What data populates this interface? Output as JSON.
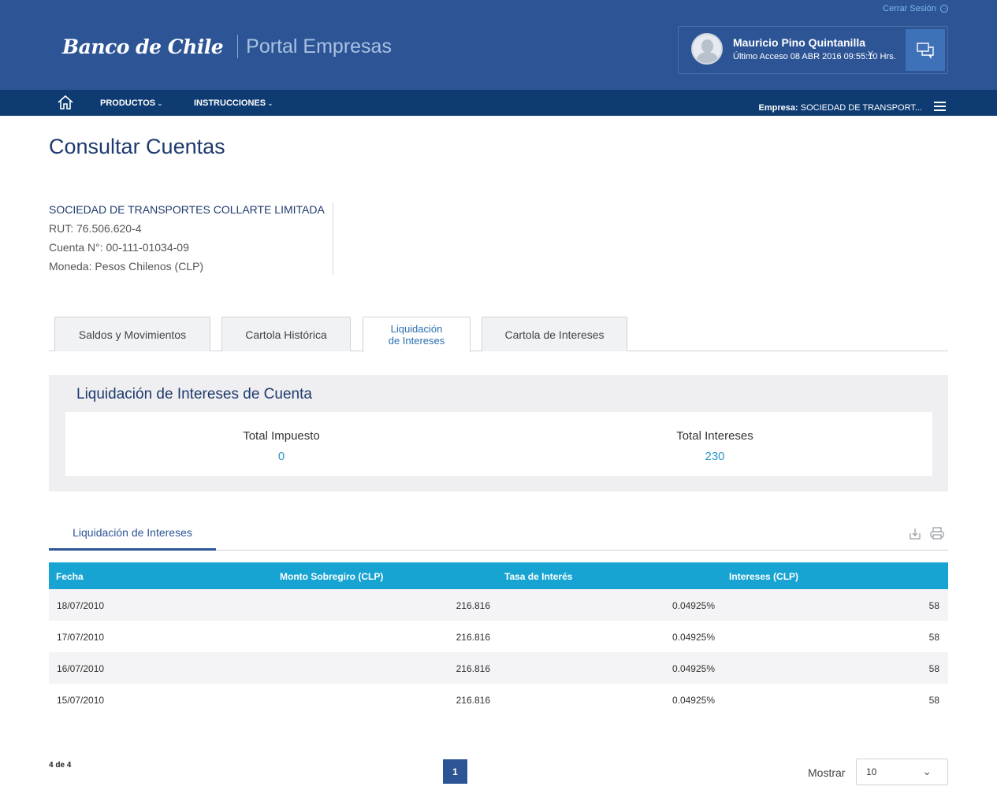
{
  "header": {
    "logout_label": "Cerrar Sesión",
    "brand_logo": "Banco de Chile",
    "brand_portal": "Portal Empresas",
    "user_name": "Mauricio Pino Quintanilla",
    "user_last_access": "Último Acceso 08 ABR 2016 09:55:10 Hrs.",
    "close_glyph": "✕"
  },
  "nav": {
    "products_label": "PRODUCTOS",
    "instructions_label": "INSTRUCCIONES",
    "company_prefix": "Empresa:",
    "company_value": "SOCIEDAD DE TRANSPORT..."
  },
  "page": {
    "title": "Consultar Cuentas"
  },
  "account": {
    "name": "SOCIEDAD DE TRANSPORTES COLLARTE LIMITADA",
    "rut": "RUT: 76.506.620-4",
    "number": "Cuenta N°: 00-111-01034-09",
    "currency": "Moneda: Pesos Chilenos (CLP)"
  },
  "tabs": {
    "t1": "Saldos y Movimientos",
    "t2": "Cartola Histórica",
    "t3_line1": "Liquidación",
    "t3_line2": "de Intereses",
    "t4": "Cartola de Intereses"
  },
  "summary": {
    "title": "Liquidación de Intereses de Cuenta",
    "tax_label": "Total Impuesto",
    "tax_value": "0",
    "interest_label": "Total Intereses",
    "interest_value": "230"
  },
  "subtab": {
    "label": "Liquidación de Intereses"
  },
  "table": {
    "headers": {
      "fecha": "Fecha",
      "monto": "Monto Sobregiro (CLP)",
      "tasa": "Tasa de Interés",
      "intereses": "Intereses (CLP)"
    },
    "rows": [
      {
        "fecha": "18/07/2010",
        "monto": "216.816",
        "tasa": "0.04925%",
        "intereses": "58"
      },
      {
        "fecha": "17/07/2010",
        "monto": "216.816",
        "tasa": "0.04925%",
        "intereses": "58"
      },
      {
        "fecha": "16/07/2010",
        "monto": "216.816",
        "tasa": "0.04925%",
        "intereses": "58"
      },
      {
        "fecha": "15/07/2010",
        "monto": "216.816",
        "tasa": "0.04925%",
        "intereses": "58"
      }
    ]
  },
  "footer": {
    "count": "4 de 4",
    "page": "1",
    "show_label": "Mostrar",
    "show_value": "10"
  },
  "colors": {
    "header_bg": "#2d5596",
    "nav_bg": "#0d3b72",
    "table_header": "#17a4d2",
    "accent_value": "#2b96c4"
  }
}
